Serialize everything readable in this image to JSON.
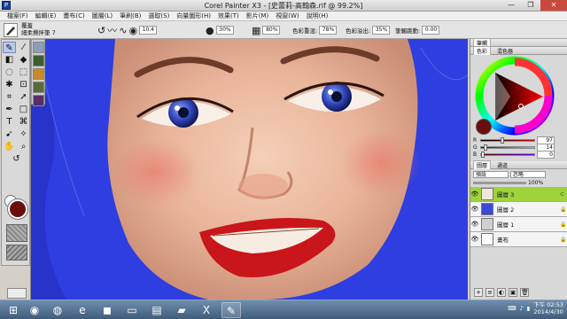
{
  "window": {
    "title": "Corel Painter X3 - [史蕾莉-高翰森.rif @ 99.2%]",
    "controls": {
      "minimize": "—",
      "maximize": "❐",
      "close": "✕"
    }
  },
  "menu": [
    "檔案(F)",
    "編輯(E)",
    "畫布(C)",
    "圖層(L)",
    "筆刷(B)",
    "選取(S)",
    "向量圖形(H)",
    "效果(T)",
    "影片(M)",
    "視窗(W)",
    "說明(H)"
  ],
  "property_bar": {
    "brush_category": "覆蓋",
    "brush_variant": "細柔攪拌筆 7",
    "size_value": "10.4",
    "opacity_value": "30%",
    "grain_value": "80%",
    "resat_label": "色彩重混:",
    "resat_value": "78%",
    "bleed_label": "色彩溢出:",
    "bleed_value": "35%",
    "jitter_label": "筆觸跳動:",
    "jitter_value": "0.00"
  },
  "tools": [
    "brush-tool",
    "dropper-tool",
    "eraser-tool",
    "fill-tool",
    "lasso-tool",
    "rect-select-tool",
    "magic-wand-tool",
    "transform-tool",
    "crop-tool",
    "layer-adjuster-tool",
    "pen-tool",
    "shape-tool",
    "text-tool",
    "divine-proportion-tool",
    "shape-selection-tool",
    "mirror-tool",
    "grabber-tool",
    "magnifier-tool",
    "rotate-page-tool"
  ],
  "colors": {
    "main_color": "#6b0e0e",
    "secondary_color": "#ffffff",
    "canvas_bg": "#2f3ee0",
    "active_layer": "#9ed33c"
  },
  "color_panel": {
    "head_tabs": [
      "色彩",
      "混色器"
    ],
    "r_label": "R",
    "r_value": "97",
    "g_label": "G",
    "g_value": "14",
    "b_label": "B",
    "b_value": "0",
    "r_level": 0.38,
    "g_level": 0.06,
    "b_level": 0.0
  },
  "top_panel": {
    "label": "筆觸"
  },
  "layers_panel": {
    "tabs": [
      "圖層",
      "通道"
    ],
    "composite_method": "預設",
    "composite_depth": "忽略",
    "opacity": "100%",
    "layers": [
      {
        "name": "圖層 3",
        "active": true,
        "locked": false
      },
      {
        "name": "圖層 2",
        "active": false,
        "locked": true
      },
      {
        "name": "圖層 1",
        "active": false,
        "locked": true
      },
      {
        "name": "畫布",
        "active": false,
        "locked": true
      }
    ]
  },
  "taskbar": {
    "apps": [
      "start",
      "chrome",
      "firefox",
      "ie",
      "line",
      "explorer",
      "unknown",
      "photoshop",
      "excel",
      "painter"
    ],
    "time": "下午 02:53",
    "date": "2014/4/30"
  }
}
